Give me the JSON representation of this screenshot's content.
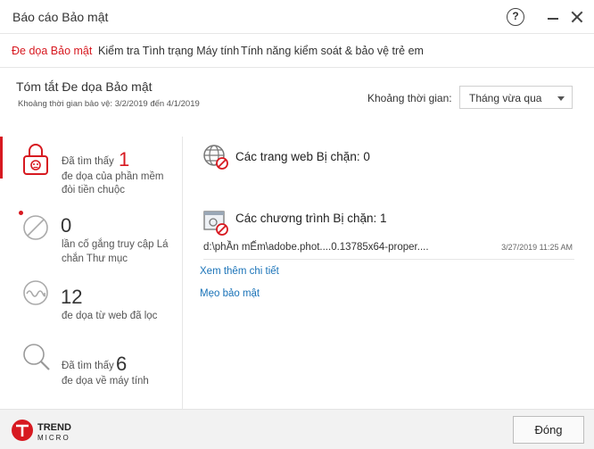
{
  "window": {
    "title": "Báo cáo Bảo mật",
    "help_label": "?"
  },
  "tabs": [
    {
      "label": "Đe dọa Bảo mật",
      "active": true
    },
    {
      "label": "Kiểm tra Tình trạng Máy tính",
      "active": false
    },
    {
      "label": "Tính năng kiểm soát & bảo vệ trẻ em",
      "active": false
    }
  ],
  "summary": {
    "title": "Tóm tắt Đe dọa Bảo mật",
    "period": "Khoảng thời gian bảo vệ: 3/2/2019 đến 4/1/2019",
    "time_label": "Khoảng thời gian:",
    "time_value": "Tháng vừa qua"
  },
  "stats": [
    {
      "prefix": "Đã tìm thấy",
      "count": "1",
      "line2": "đe dọa của phần mềm",
      "line3": "đòi tiền chuộc"
    },
    {
      "count": "0",
      "line2": "lần cố gắng truy cập Lá",
      "line3": "chắn Thư mục"
    },
    {
      "count": "12",
      "line2": "đe dọa từ web đã lọc"
    },
    {
      "prefix": "Đã tìm thấy",
      "count": "6",
      "line2": "đe dọa về máy tính"
    }
  ],
  "blocked_web": {
    "title": "Các trang web Bị chặn: 0"
  },
  "blocked_programs": {
    "title": "Các chương trình Bị chặn: 1",
    "items": [
      {
        "path": "d:\\phẦn mẾm\\adobe.phot....0.13785x64-proper....",
        "time": "3/27/2019 11:25 AM"
      }
    ]
  },
  "links": {
    "more": "Xem thêm chi tiết",
    "tips": "Mẹo bảo mật"
  },
  "footer": {
    "logo_line1": "TREND",
    "logo_line2": "MICRO",
    "close_label": "Đóng"
  },
  "colors": {
    "accent": "#d71920",
    "link": "#1a73b8"
  }
}
